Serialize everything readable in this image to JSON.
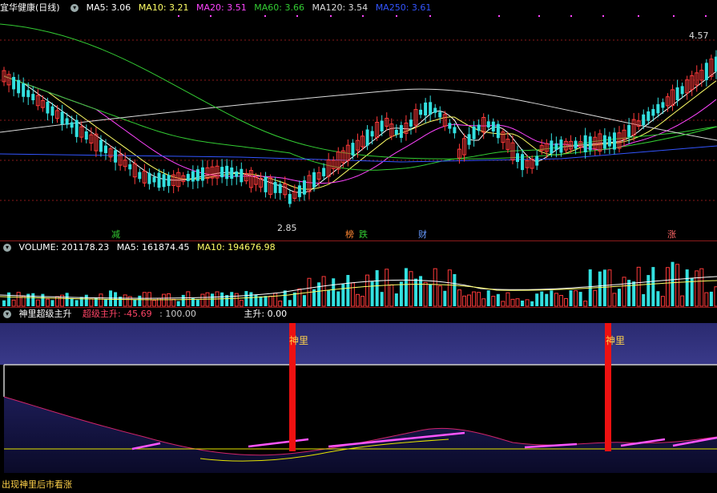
{
  "main_header": {
    "title": "宜华健康(日线)",
    "ma5": "MA5: 3.06",
    "ma10": "MA10: 3.21",
    "ma20": "MA20: 3.51",
    "ma60": "MA60: 3.66",
    "ma120": "MA120: 3.54",
    "ma250": "MA250: 3.61"
  },
  "price_labels": {
    "high": "4.57",
    "low": "2.85"
  },
  "event_tags": {
    "jian": "减",
    "bang": "榜",
    "die": "跌",
    "cai": "财",
    "zhang": "涨"
  },
  "volume_header": {
    "volume": "VOLUME: 201178.23",
    "ma5": "MA5: 161874.45",
    "ma10": "MA10: 194676.98"
  },
  "indicator_header": {
    "name": "神里超级主升",
    "value": "超级主升: -45.69",
    "level": ": 100.00",
    "zhusheng": "主升: 0.00"
  },
  "signal_labels": [
    "神里",
    "神里"
  ],
  "footer_note": "出现神里后市看涨",
  "colors": {
    "candle_up": "#ff3a3a",
    "candle_down": "#33e0e0",
    "ma5": "#ffffff",
    "ma10": "#ffff66",
    "ma20": "#ff44ff",
    "ma60": "#33cc33",
    "ma120": "#dddddd",
    "ma250": "#3355ff",
    "grid": "#8b1a1a"
  }
}
